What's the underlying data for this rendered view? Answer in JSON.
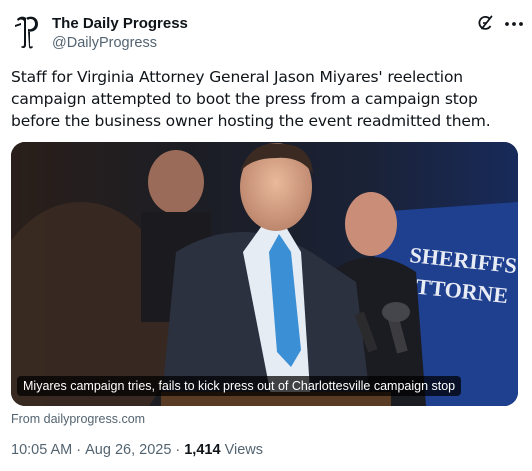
{
  "account": {
    "display_name": "The Daily Progress",
    "handle": "@DailyProgress",
    "avatar_icon": "daily-progress-blackletter-p-logo"
  },
  "header_actions": {
    "grok_icon": "grok-icon",
    "more_icon": "more-options-icon"
  },
  "tweet": {
    "text": "Staff for Virginia Attorney General Jason Miyares' reelection campaign attempted to boot the press from a campaign stop before the business owner hosting the event readmitted them."
  },
  "card": {
    "image_description_icon": "news-photo",
    "headline": "Miyares campaign tries, fails to kick press out of Charlottesville campaign stop",
    "source": "From dailyprogress.com",
    "photo_sign_text": [
      "SHERIFFS",
      "ATTORNE"
    ]
  },
  "meta": {
    "time": "10:05 AM",
    "date": "Aug 26, 2025",
    "views_count": "1,414",
    "views_label": "Views"
  },
  "colors": {
    "primary_text": "#0f1419",
    "secondary_text": "#536471",
    "card_background": "#161a22",
    "sign_blue": "#1f3f8f"
  }
}
